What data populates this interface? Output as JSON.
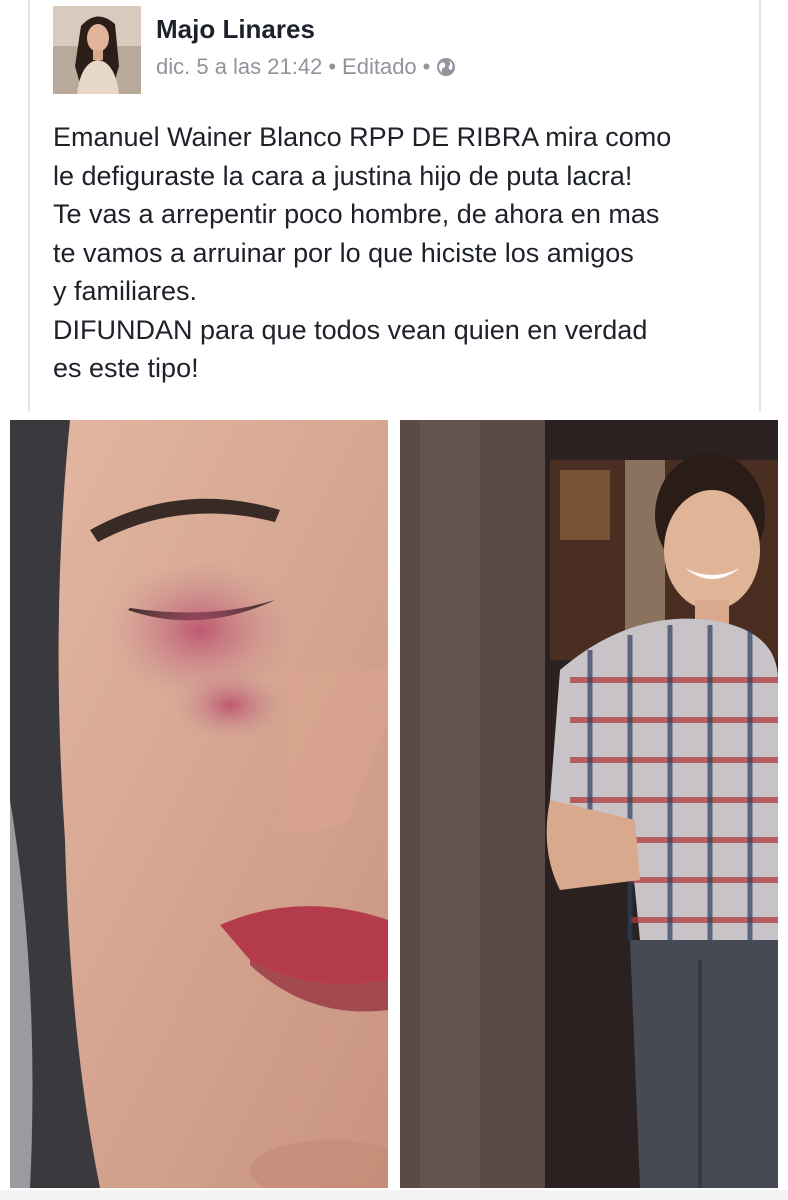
{
  "post": {
    "author": "Majo Linares",
    "date": "dic. 5 a las 21:42",
    "edited_label": "Editado",
    "separator": "•",
    "privacy_icon": "globe-icon",
    "text_lines": [
      "Emanuel Wainer Blanco RPP DE RIBRA mira como",
      "le defiguraste la cara a justina hijo de puta lacra!",
      "Te vas a arrepentir poco hombre, de ahora en mas",
      "te vamos a arruinar por lo que hiciste los amigos",
      "y familiares.",
      "DIFUNDAN para que todos vean quien en verdad",
      "es este tipo!"
    ]
  },
  "photos": {
    "left": "close-up-face-photo",
    "right": "man-plaid-shirt-photo"
  },
  "colors": {
    "text": "#1d2129",
    "meta": "#90949c",
    "card_border": "#e3e5e9"
  }
}
